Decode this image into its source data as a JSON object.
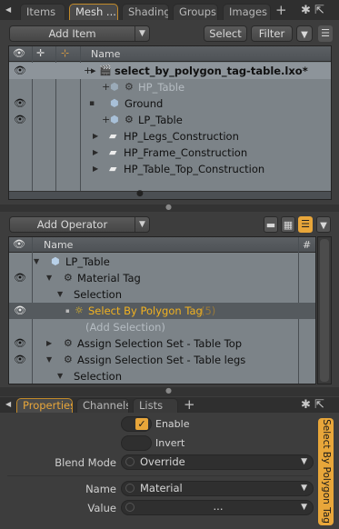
{
  "top_tabs": [
    {
      "label": "Items"
    },
    {
      "label": "Mesh ..."
    },
    {
      "label": "Shading"
    },
    {
      "label": "Groups"
    },
    {
      "label": "Images"
    }
  ],
  "top_tabs_plus": "+",
  "item_toolbar": {
    "add_item": "Add Item",
    "select": "Select",
    "filter": "Filter"
  },
  "item_list": {
    "name_header": "Name",
    "rows": [
      {
        "label": "select_by_polygon_tag-table.lxo*",
        "visible": true,
        "expander": "+",
        "icon": "scene-icon"
      },
      {
        "label": "HP_Table",
        "visible": false,
        "expander": "+",
        "icon": "mesh-icon",
        "dim": true
      },
      {
        "label": "Ground",
        "visible": true,
        "expander": "",
        "icon": "mesh-icon"
      },
      {
        "label": "LP_Table",
        "visible": true,
        "expander": "+",
        "icon": "mesh-icon"
      },
      {
        "label": "HP_Legs_Construction",
        "visible": false,
        "expander": "▶",
        "icon": "folder-icon"
      },
      {
        "label": "HP_Frame_Construction",
        "visible": false,
        "expander": "▶",
        "icon": "folder-icon"
      },
      {
        "label": "HP_Table_Top_Construction",
        "visible": false,
        "expander": "▶",
        "icon": "folder-icon"
      }
    ]
  },
  "operator_toolbar": {
    "add_operator": "Add Operator"
  },
  "operator_list": {
    "name_header": "Name",
    "hash_header": "#",
    "rows": [
      {
        "label": "LP_Table",
        "visible": false
      },
      {
        "label": "Material Tag",
        "visible": true
      },
      {
        "label": "Selection",
        "visible": false
      },
      {
        "label": "Select By Polygon Tag",
        "count": "(5)",
        "visible": true,
        "highlight": true
      },
      {
        "label": "(Add Selection)",
        "visible": false,
        "dim": true
      },
      {
        "label": "Assign Selection Set - Table Top",
        "visible": true
      },
      {
        "label": "Assign Selection Set - Table legs",
        "visible": true
      },
      {
        "label": "Selection",
        "visible": false
      }
    ]
  },
  "prop_tabs": [
    {
      "label": "Properties"
    },
    {
      "label": "Channels"
    },
    {
      "label": "Lists"
    }
  ],
  "properties": {
    "enable_label": "Enable",
    "enable_checked": true,
    "invert_label": "Invert",
    "blend_mode_label": "Blend Mode",
    "blend_mode_value": "Override",
    "name_label": "Name",
    "name_value": "Material",
    "value_label": "Value",
    "value_value": "..."
  },
  "side_tab_label": "Select By Polygon Tag",
  "colors": {
    "accent": "#e8a63a",
    "list_bg": "#7c8388",
    "highlight_text": "#f0b020"
  }
}
